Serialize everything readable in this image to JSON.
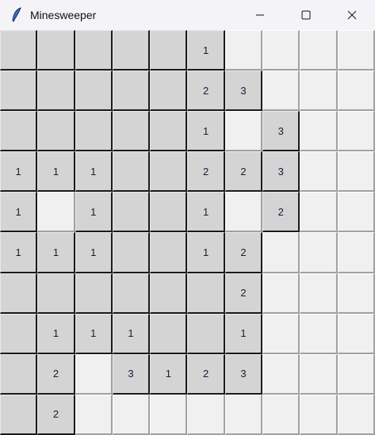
{
  "window": {
    "title": "Minesweeper",
    "icon": "feather-icon"
  },
  "board": {
    "legend": {
      "0": "revealed-empty",
      ".": "unrevealed",
      "digit": "revealed-number"
    },
    "rows": [
      [
        "0",
        "0",
        "0",
        "0",
        "0",
        "1",
        ".",
        ".",
        ".",
        "."
      ],
      [
        "0",
        "0",
        "0",
        "0",
        "0",
        "2",
        "3",
        ".",
        ".",
        "."
      ],
      [
        "0",
        "0",
        "0",
        "0",
        "0",
        "1",
        ".",
        "3",
        ".",
        "."
      ],
      [
        "1",
        "1",
        "1",
        "0",
        "0",
        "2",
        "2",
        "3",
        ".",
        "."
      ],
      [
        "1",
        ".",
        "1",
        "0",
        "0",
        "1",
        ".",
        "2",
        ".",
        "."
      ],
      [
        "1",
        "1",
        "1",
        "0",
        "0",
        "1",
        "2",
        ".",
        ".",
        "."
      ],
      [
        "0",
        "0",
        "0",
        "0",
        "0",
        "0",
        "2",
        ".",
        ".",
        "."
      ],
      [
        "0",
        "1",
        "1",
        "1",
        "0",
        "0",
        "1",
        ".",
        ".",
        "."
      ],
      [
        "0",
        "2",
        ".",
        "3",
        "1",
        "2",
        "3",
        ".",
        ".",
        "."
      ],
      [
        "0",
        "2",
        ".",
        ".",
        ".",
        ".",
        ".",
        ".",
        ".",
        "."
      ]
    ]
  }
}
